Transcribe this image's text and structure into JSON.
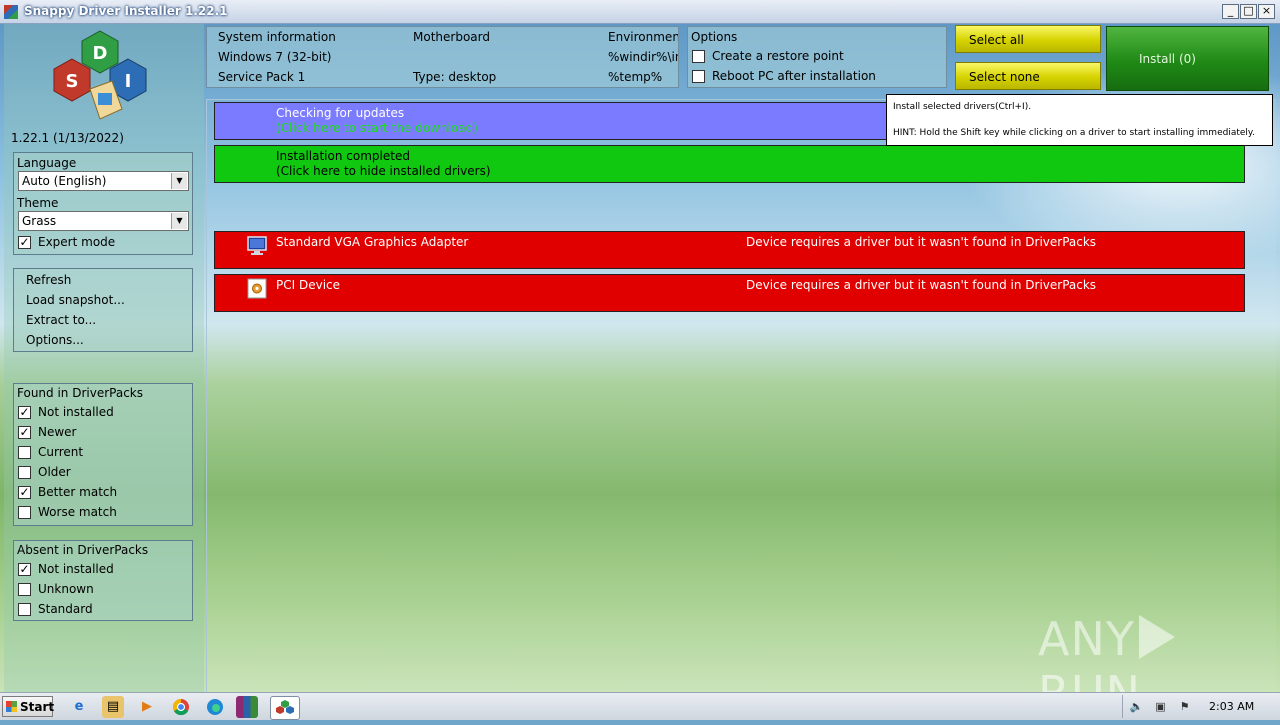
{
  "window": {
    "title": "Snappy Driver Installer 1.22.1",
    "minimize_glyph": "_",
    "maximize_glyph": "□",
    "close_glyph": "×"
  },
  "sidebar": {
    "version": "1.22.1 (1/13/2022)",
    "language_label": "Language",
    "language_value": "Auto (English)",
    "theme_label": "Theme",
    "theme_value": "Grass",
    "expert_mode_label": "Expert mode",
    "expert_mode_checked": true,
    "menu": {
      "refresh": "Refresh",
      "load_snapshot": "Load snapshot...",
      "extract_to": "Extract to...",
      "options": "Options..."
    },
    "found": {
      "title": "Found in DriverPacks",
      "items": [
        {
          "label": "Not installed",
          "checked": true
        },
        {
          "label": "Newer",
          "checked": true
        },
        {
          "label": "Current",
          "checked": false
        },
        {
          "label": "Older",
          "checked": false
        },
        {
          "label": "Better match",
          "checked": true
        },
        {
          "label": "Worse match",
          "checked": false
        }
      ]
    },
    "absent": {
      "title": "Absent in DriverPacks",
      "items": [
        {
          "label": "Not installed",
          "checked": true
        },
        {
          "label": "Unknown",
          "checked": false
        },
        {
          "label": "Standard",
          "checked": false
        }
      ]
    }
  },
  "sysinfo": {
    "col1_header": "System information",
    "os": "Windows 7 (32-bit)",
    "service_pack": "Service Pack 1",
    "col2_header": "Motherboard",
    "type": "Type: desktop",
    "col3_header": "Environment",
    "windir": "%windir%\\in",
    "temp": "%temp%"
  },
  "options": {
    "title": "Options",
    "restore_point": "Create a restore point",
    "reboot": "Reboot PC after installation"
  },
  "buttons": {
    "select_all": "Select all",
    "select_none": "Select none",
    "install": "Install (0)"
  },
  "rows": {
    "updates_line1": "Checking for updates",
    "updates_line2": "(Click here to start the download)",
    "completed_line1": "Installation completed",
    "completed_line2": "(Click here to hide installed drivers)",
    "vga_name": "Standard VGA Graphics Adapter",
    "vga_status": "Device requires a driver but it wasn't found in DriverPacks",
    "pci_name": "PCI Device",
    "pci_status": "Device requires a driver but it wasn't found in DriverPacks"
  },
  "tooltip": {
    "line1": "Install selected drivers(Ctrl+I).",
    "line2": "HINT: Hold the Shift key while clicking on a driver to start installing immediately."
  },
  "watermark": {
    "left": "ANY",
    "right": "RUN"
  },
  "taskbar": {
    "start": "Start",
    "clock": "2:03 AM",
    "icons": [
      "ie-icon",
      "explorer-icon",
      "media-player-icon",
      "chrome-icon",
      "edge-icon",
      "winrar-icon",
      "sdi-taskbar-icon"
    ]
  },
  "colors": {
    "updates_row": "#7b7bff",
    "completed_row": "#10c810",
    "missing_driver_row": "#e00000",
    "download_link_text": "#22dd22"
  }
}
